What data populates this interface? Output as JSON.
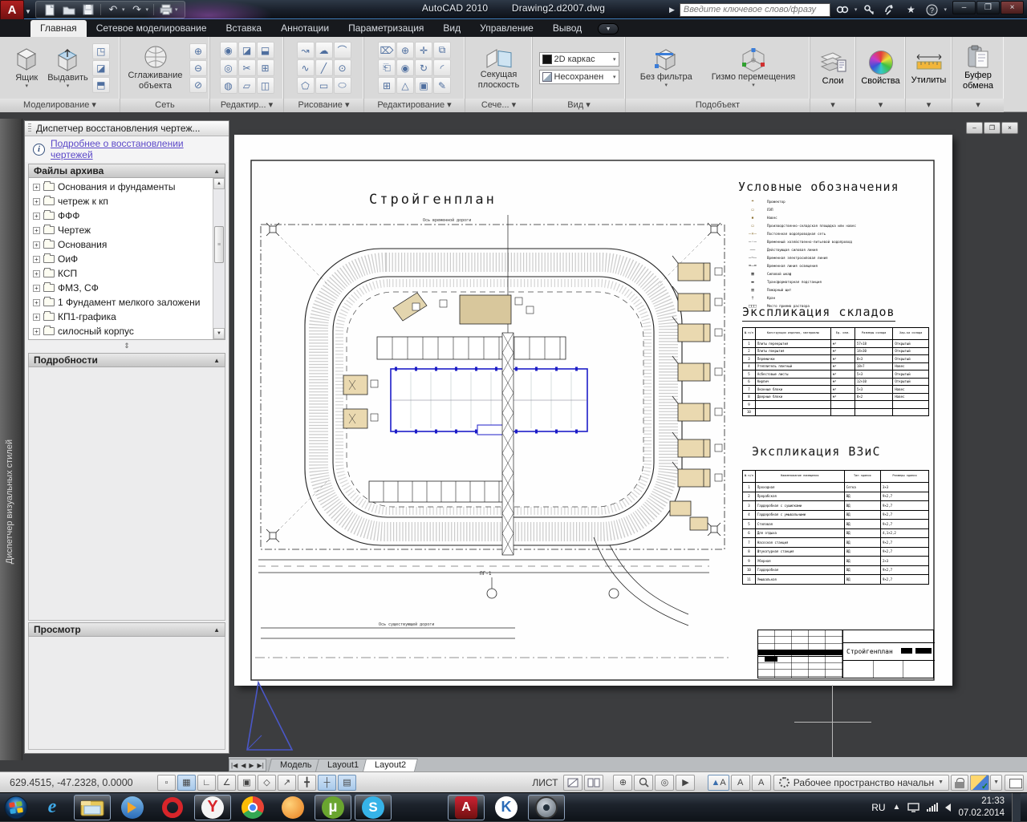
{
  "window": {
    "app_title": "AutoCAD 2010",
    "doc_title": "Drawing2.d2007.dwg"
  },
  "infocenter": {
    "placeholder": "Введите ключевое слово/фразу"
  },
  "ribbon": {
    "active_tab": "Главная",
    "tabs": [
      "Главная",
      "Сетевое моделирование",
      "Вставка",
      "Аннотации",
      "Параметризация",
      "Вид",
      "Управление",
      "Вывод"
    ],
    "panels": {
      "modeling": {
        "caption": "Моделирование ▾",
        "btn_box": "Ящик",
        "btn_extrude": "Выдавить"
      },
      "mesh": {
        "caption": "Сеть",
        "btn_smooth": "Сглаживание объекта"
      },
      "mesh_edit": {
        "caption": "Редактир... ▾"
      },
      "draw": {
        "caption": "Рисование ▾"
      },
      "modify": {
        "caption": "Редактирование ▾"
      },
      "section": {
        "caption": "Сече... ▾",
        "btn_plane": "Секущая плоскость"
      },
      "view": {
        "caption": "Вид ▾",
        "combo_visual": "2D каркас",
        "combo_views": "Несохранен"
      },
      "subobject": {
        "caption": "Подобъект",
        "btn_filter": "Без фильтра",
        "btn_gizmo": "Гизмо перемещения"
      },
      "layers": {
        "label": "Слои"
      },
      "properties": {
        "label": "Свойства"
      },
      "utilities": {
        "label": "Утилиты"
      },
      "clipboard": {
        "label1": "Буфер",
        "label2": "обмена"
      }
    }
  },
  "palette": {
    "title": "Диспетчер восстановления чертеж...",
    "info_link": "Подробнее о восстановлении чертежей",
    "files_header": "Файлы архива",
    "details_header": "Подробности",
    "preview_header": "Просмотр",
    "side_label": "Диспетчер визуальных стилей",
    "tree": [
      "Основания и фундаменты",
      "четреж к кп",
      "ФФФ",
      "Чертеж",
      "Основания",
      "ОиФ",
      "КСП",
      "ФМЗ, СФ",
      "1 Фундамент мелкого заложени",
      "КП1-графика",
      "силосный корпус"
    ]
  },
  "drawing": {
    "plan_title": "Стройгенплан",
    "axis_top_label": "Ось временной дороги",
    "axis_bottom_label": "Ось существующей дороги",
    "hydrant_label": "ПГ-1",
    "legend": {
      "title": "Условные обозначения",
      "items": [
        {
          "sym": "⌖",
          "label": "Прожектор"
        },
        {
          "sym": "▭",
          "label": "ЛЭП"
        },
        {
          "sym": "▪",
          "label": "Навес"
        },
        {
          "sym": "▭",
          "label": "Производственно-складская площадка или навес"
        },
        {
          "sym": "–×–",
          "label": "Постоянная водопроводная сеть"
        },
        {
          "sym": "–·–",
          "label": "Временный хозяйственно-питьевой водопровод"
        },
        {
          "sym": "——",
          "label": "Действующая силовая линия"
        },
        {
          "sym": "–~–",
          "label": "Временная электросиловая линия"
        },
        {
          "sym": "=–=",
          "label": "Временная линия освещения"
        },
        {
          "sym": "▦",
          "label": "Силовой шкаф"
        },
        {
          "sym": "▬",
          "label": "Трансформаторная подстанция"
        },
        {
          "sym": "▥",
          "label": "Пожарный щит"
        },
        {
          "sym": "†",
          "label": "Кран"
        },
        {
          "sym": "□□□",
          "label": "Место приема раствора"
        }
      ]
    },
    "sklad_table": {
      "title": "Экспликация складов",
      "headers": [
        "№ п/п",
        "Конструкции изделия, материалы",
        "Ед. изм.",
        "Размеры склада",
        "Хар-ка склада"
      ],
      "rows": [
        [
          "1",
          "Плиты перекрытия",
          "м²",
          "57×18",
          "Открытый"
        ],
        [
          "2",
          "Плиты покрытия",
          "м²",
          "14×30",
          "Открытый"
        ],
        [
          "3",
          "Перемычки",
          "м²",
          "8×3",
          "Открытый"
        ],
        [
          "4",
          "Утеплитель плитный",
          "м²",
          "18×7",
          "Навес"
        ],
        [
          "5",
          "Асбестовые листы",
          "м²",
          "5×3",
          "Открытый"
        ],
        [
          "6",
          "Кирпич",
          "м²",
          "12×10",
          "Открытый"
        ],
        [
          "7",
          "Оконные блоки",
          "м²",
          "5×3",
          "Навес"
        ],
        [
          "8",
          "Дверные блоки",
          "м²",
          "8×2",
          "Навес"
        ],
        [
          "9",
          "",
          "",
          "",
          ""
        ],
        [
          "10",
          "",
          "",
          "",
          ""
        ]
      ]
    },
    "vzis_table": {
      "title": "Экспликация ВЗиС",
      "headers": [
        "№ п/п",
        "Наименование помещения",
        "Тип здания",
        "Размеры здания"
      ],
      "rows": [
        [
          "1",
          "Проходная",
          "Сетка",
          "3×3"
        ],
        [
          "2",
          "Прорабская",
          "ВД",
          "9×2,7"
        ],
        [
          "3",
          "Гардеробная с сушилками",
          "ВД",
          "9×2,7"
        ],
        [
          "4",
          "Гардеробная с умывальными",
          "ВД",
          "9×2,7"
        ],
        [
          "5",
          "Столовая",
          "ВД",
          "9×2,7"
        ],
        [
          "6",
          "Для отдыха",
          "ВД",
          "4,1×2,2"
        ],
        [
          "7",
          "Насосная станция",
          "ВД",
          "9×2,7"
        ],
        [
          "8",
          "Штукатурная станция",
          "ВД",
          "9×2,7"
        ],
        [
          "9",
          "Уборная",
          "ВД",
          "2×3"
        ],
        [
          "10",
          "Гардеробная",
          "ВД",
          "9×2,7"
        ],
        [
          "11",
          "Умывальная",
          "ВД",
          "9×2,7"
        ]
      ]
    },
    "stamp_title": "Стройгенплан"
  },
  "layout_tabs": {
    "model": "Модель",
    "layout1": "Layout1",
    "layout2": "Layout2",
    "active": "Layout2"
  },
  "statusbar": {
    "coords": "629.4515, -47.2328, 0.0000",
    "sheet_label": "ЛИСТ",
    "workspace": "Рабочее пространство начальн",
    "toggles": [
      {
        "name": "snap-toggle",
        "glyph": "▫",
        "on": false
      },
      {
        "name": "grid-toggle",
        "glyph": "▦",
        "on": true
      },
      {
        "name": "ortho-toggle",
        "glyph": "∟",
        "on": false
      },
      {
        "name": "polar-toggle",
        "glyph": "∠",
        "on": false
      },
      {
        "name": "osnap-toggle",
        "glyph": "▣",
        "on": false
      },
      {
        "name": "osnap3d-toggle",
        "glyph": "◇",
        "on": false
      },
      {
        "name": "otrack-toggle",
        "glyph": "↗",
        "on": false
      },
      {
        "name": "ducs-toggle",
        "glyph": "╋",
        "on": false
      },
      {
        "name": "dyn-toggle",
        "glyph": "┼",
        "on": true
      },
      {
        "name": "qp-toggle",
        "glyph": "▤",
        "on": true
      }
    ]
  },
  "taskbar": {
    "lang": "RU",
    "time": "21:33",
    "date": "07.02.2014"
  },
  "colors": {
    "accent_blue": "#1d1dc8",
    "beige": "#ead9b0",
    "titlebar": "#1b222d",
    "link_purple": "#5b48c8"
  }
}
